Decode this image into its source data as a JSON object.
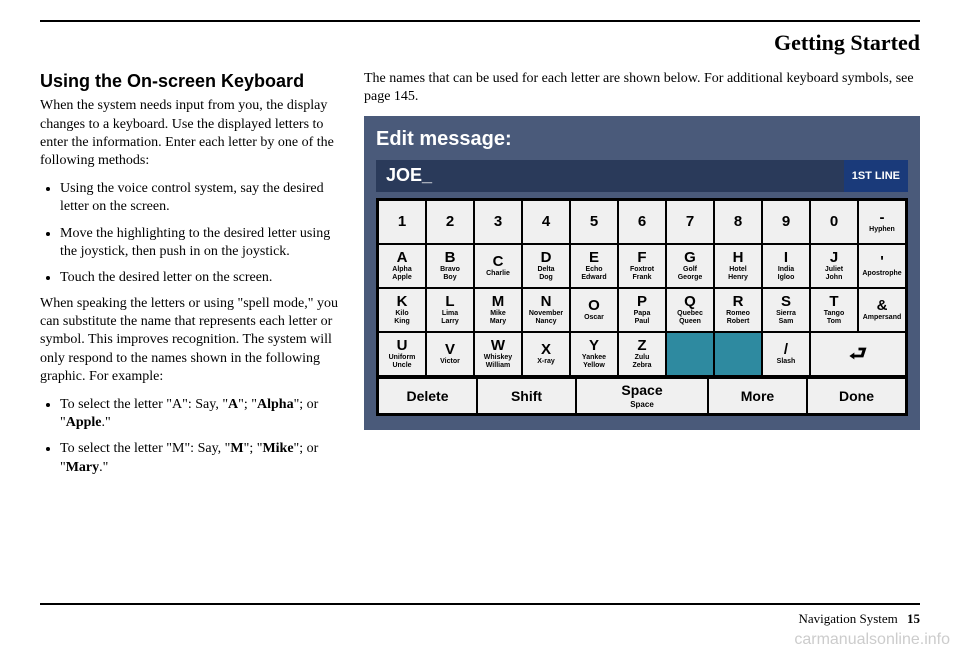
{
  "chapter": "Getting Started",
  "left": {
    "heading": "Using the On-screen Keyboard",
    "intro": "When the system needs input from you, the display changes to a keyboard. Use the displayed letters to enter the information. Enter each letter by one of the following methods:",
    "methods": [
      "Using the voice control system, say the desired letter on the screen.",
      "Move the highlighting to the desired letter using the joystick, then push in on the joystick.",
      "Touch the desired letter on the screen."
    ],
    "spell_intro": "When speaking the letters or using \"spell mode,\" you can substitute the name that represents each letter or symbol. This improves recognition. The system will only respond to the names shown in the following graphic. For example:",
    "ex_a_prefix": "To select the letter \"A\": Say, \"",
    "ex_a_b1": "A",
    "ex_a_mid1": "\"; \"",
    "ex_a_b2": "Alpha",
    "ex_a_mid2": "\"; or \"",
    "ex_a_b3": "Apple",
    "ex_a_suffix": ".\"",
    "ex_m_prefix": "To select the letter \"M\": Say, \"",
    "ex_m_b1": "M",
    "ex_m_mid1": "\"; \"",
    "ex_m_b2": "Mike",
    "ex_m_mid2": "\"; or \"",
    "ex_m_b3": "Mary",
    "ex_m_suffix": ".\""
  },
  "right": {
    "intro": "The names that can be used for each letter are shown below. For additional keyboard symbols, see page 145."
  },
  "keyboard": {
    "title": "Edit message:",
    "input_value": "JOE_",
    "line_badge": "1ST LINE",
    "row1": [
      {
        "main": "1"
      },
      {
        "main": "2"
      },
      {
        "main": "3"
      },
      {
        "main": "4"
      },
      {
        "main": "5"
      },
      {
        "main": "6"
      },
      {
        "main": "7"
      },
      {
        "main": "8"
      },
      {
        "main": "9"
      },
      {
        "main": "0"
      },
      {
        "main": "-",
        "sub1": "Hyphen"
      }
    ],
    "row2": [
      {
        "main": "A",
        "sub1": "Alpha",
        "sub2": "Apple"
      },
      {
        "main": "B",
        "sub1": "Bravo",
        "sub2": "Boy"
      },
      {
        "main": "C",
        "sub1": "Charlie"
      },
      {
        "main": "D",
        "sub1": "Delta",
        "sub2": "Dog"
      },
      {
        "main": "E",
        "sub1": "Echo",
        "sub2": "Edward"
      },
      {
        "main": "F",
        "sub1": "Foxtrot",
        "sub2": "Frank"
      },
      {
        "main": "G",
        "sub1": "Golf",
        "sub2": "George"
      },
      {
        "main": "H",
        "sub1": "Hotel",
        "sub2": "Henry"
      },
      {
        "main": "I",
        "sub1": "India",
        "sub2": "Igloo"
      },
      {
        "main": "J",
        "sub1": "Juliet",
        "sub2": "John"
      },
      {
        "main": "'",
        "sub1": "Apostrophe"
      }
    ],
    "row3": [
      {
        "main": "K",
        "sub1": "Kilo",
        "sub2": "King"
      },
      {
        "main": "L",
        "sub1": "Lima",
        "sub2": "Larry"
      },
      {
        "main": "M",
        "sub1": "Mike",
        "sub2": "Mary"
      },
      {
        "main": "N",
        "sub1": "November",
        "sub2": "Nancy"
      },
      {
        "main": "O",
        "sub1": "Oscar"
      },
      {
        "main": "P",
        "sub1": "Papa",
        "sub2": "Paul"
      },
      {
        "main": "Q",
        "sub1": "Quebec",
        "sub2": "Queen"
      },
      {
        "main": "R",
        "sub1": "Romeo",
        "sub2": "Robert"
      },
      {
        "main": "S",
        "sub1": "Sierra",
        "sub2": "Sam"
      },
      {
        "main": "T",
        "sub1": "Tango",
        "sub2": "Tom"
      },
      {
        "main": "&",
        "sub1": "Ampersand"
      }
    ],
    "row4": [
      {
        "main": "U",
        "sub1": "Uniform",
        "sub2": "Uncle"
      },
      {
        "main": "V",
        "sub1": "Victor"
      },
      {
        "main": "W",
        "sub1": "Whiskey",
        "sub2": "William"
      },
      {
        "main": "X",
        "sub1": "X-ray"
      },
      {
        "main": "Y",
        "sub1": "Yankee",
        "sub2": "Yellow"
      },
      {
        "main": "Z",
        "sub1": "Zulu",
        "sub2": "Zebra"
      },
      {
        "blank": true
      },
      {
        "blank": true
      },
      {
        "main": "/",
        "sub1": "Slash"
      },
      {
        "enter": true,
        "span": 2
      }
    ],
    "bottom": [
      {
        "label": "Delete"
      },
      {
        "label": "Shift"
      },
      {
        "label": "Space",
        "sub": "Space"
      },
      {
        "label": "More"
      },
      {
        "label": "Done"
      }
    ]
  },
  "footer": {
    "label": "Navigation System",
    "page": "15"
  },
  "watermark": "carmanualsonline.info"
}
